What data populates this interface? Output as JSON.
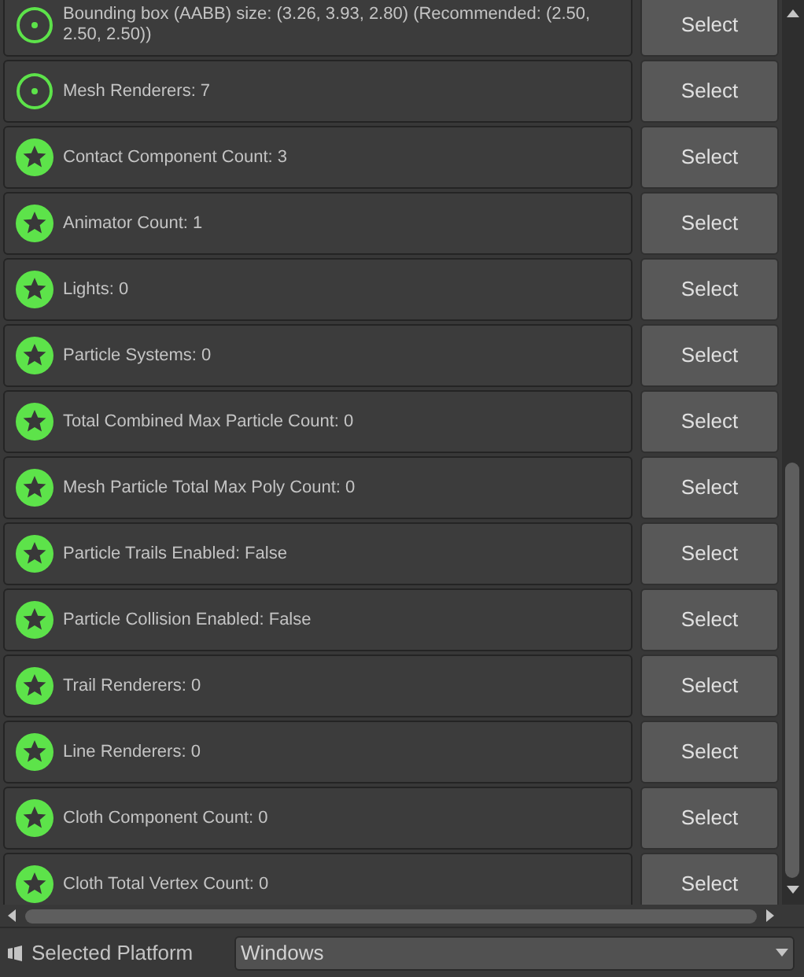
{
  "checks": [
    {
      "kind": "dot",
      "label": "Bounding box (AABB) size: (3.26, 3.93, 2.80) (Recommended: (2.50, 2.50, 2.50))",
      "button": "Select"
    },
    {
      "kind": "dot",
      "label": "Mesh Renderers: 7",
      "button": "Select"
    },
    {
      "kind": "star",
      "label": "Contact Component Count: 3",
      "button": "Select"
    },
    {
      "kind": "star",
      "label": "Animator Count: 1",
      "button": "Select"
    },
    {
      "kind": "star",
      "label": "Lights: 0",
      "button": "Select"
    },
    {
      "kind": "star",
      "label": "Particle Systems: 0",
      "button": "Select"
    },
    {
      "kind": "star",
      "label": "Total Combined Max Particle Count: 0",
      "button": "Select"
    },
    {
      "kind": "star",
      "label": "Mesh Particle Total Max Poly Count: 0",
      "button": "Select"
    },
    {
      "kind": "star",
      "label": "Particle Trails Enabled: False",
      "button": "Select"
    },
    {
      "kind": "star",
      "label": "Particle Collision Enabled: False",
      "button": "Select"
    },
    {
      "kind": "star",
      "label": "Trail Renderers: 0",
      "button": "Select"
    },
    {
      "kind": "star",
      "label": "Line Renderers: 0",
      "button": "Select"
    },
    {
      "kind": "star",
      "label": "Cloth Component Count: 0",
      "button": "Select"
    },
    {
      "kind": "star",
      "label": "Cloth Total Vertex Count: 0",
      "button": "Select"
    }
  ],
  "platform": {
    "label": "Selected Platform",
    "value": "Windows"
  }
}
